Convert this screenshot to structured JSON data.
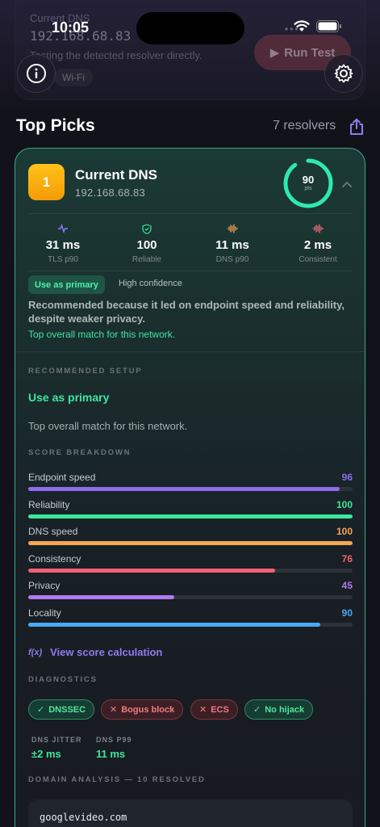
{
  "status_bar": {
    "time": "10:05"
  },
  "background_card": {
    "label": "Current DNS",
    "ip": "192.168.68.83",
    "description": "Testing the detected resolver directly.",
    "network": "Wi-Fi",
    "run_button": "Run Test"
  },
  "header": {
    "title": "Top Picks",
    "resolver_count": "7 resolvers"
  },
  "card": {
    "rank": "1",
    "name": "Current DNS",
    "ip": "192.168.68.83",
    "score": "90",
    "score_unit": "pts",
    "score_fraction": 0.9,
    "metrics": [
      {
        "icon": "pulse-icon",
        "value": "31 ms",
        "label": "TLS p90",
        "color": "#8f7bf0"
      },
      {
        "icon": "shield-check-icon",
        "value": "100",
        "label": "Reliable",
        "color": "#3ee69d"
      },
      {
        "icon": "waveform-icon",
        "value": "11 ms",
        "label": "DNS p90",
        "color": "#f0a050"
      },
      {
        "icon": "waveform-icon",
        "value": "2 ms",
        "label": "Consistent",
        "color": "#f06a7a"
      }
    ],
    "primary_pill": "Use as primary",
    "confidence": "High confidence",
    "reason": "Recommended because it led on endpoint speed and reliability, despite weaker privacy.",
    "reason_note": "Top overall match for this network.",
    "recommended_setup_label": "RECOMMENDED SETUP",
    "recommended_primary": "Use as primary",
    "recommended_desc": "Top overall match for this network.",
    "score_breakdown_label": "SCORE BREAKDOWN",
    "breakdown": [
      {
        "label": "Endpoint speed",
        "value": "96",
        "fraction": 0.96,
        "color": "#8f6cf0"
      },
      {
        "label": "Reliability",
        "value": "100",
        "fraction": 1.0,
        "color": "#3ee69d"
      },
      {
        "label": "DNS speed",
        "value": "100",
        "fraction": 1.0,
        "color": "#f4a556"
      },
      {
        "label": "Consistency",
        "value": "76",
        "fraction": 0.76,
        "color": "#f06070"
      },
      {
        "label": "Privacy",
        "value": "45",
        "fraction": 0.45,
        "color": "#b07af0"
      },
      {
        "label": "Locality",
        "value": "90",
        "fraction": 0.9,
        "color": "#4aa8f5"
      }
    ],
    "calc_link_fx": "f(x)",
    "calc_link": "View score calculation",
    "diagnostics_label": "DIAGNOSTICS",
    "diagnostics": [
      {
        "label": "DNSSEC",
        "status": "good"
      },
      {
        "label": "Bogus block",
        "status": "bad"
      },
      {
        "label": "ECS",
        "status": "bad"
      },
      {
        "label": "No hijack",
        "status": "good"
      }
    ],
    "stats": [
      {
        "label": "DNS JITTER",
        "value": "±2 ms"
      },
      {
        "label": "DNS P99",
        "value": "11 ms"
      }
    ],
    "domain_analysis_label": "DOMAIN ANALYSIS — 10 RESOLVED",
    "domains": [
      "googlevideo.com"
    ]
  }
}
